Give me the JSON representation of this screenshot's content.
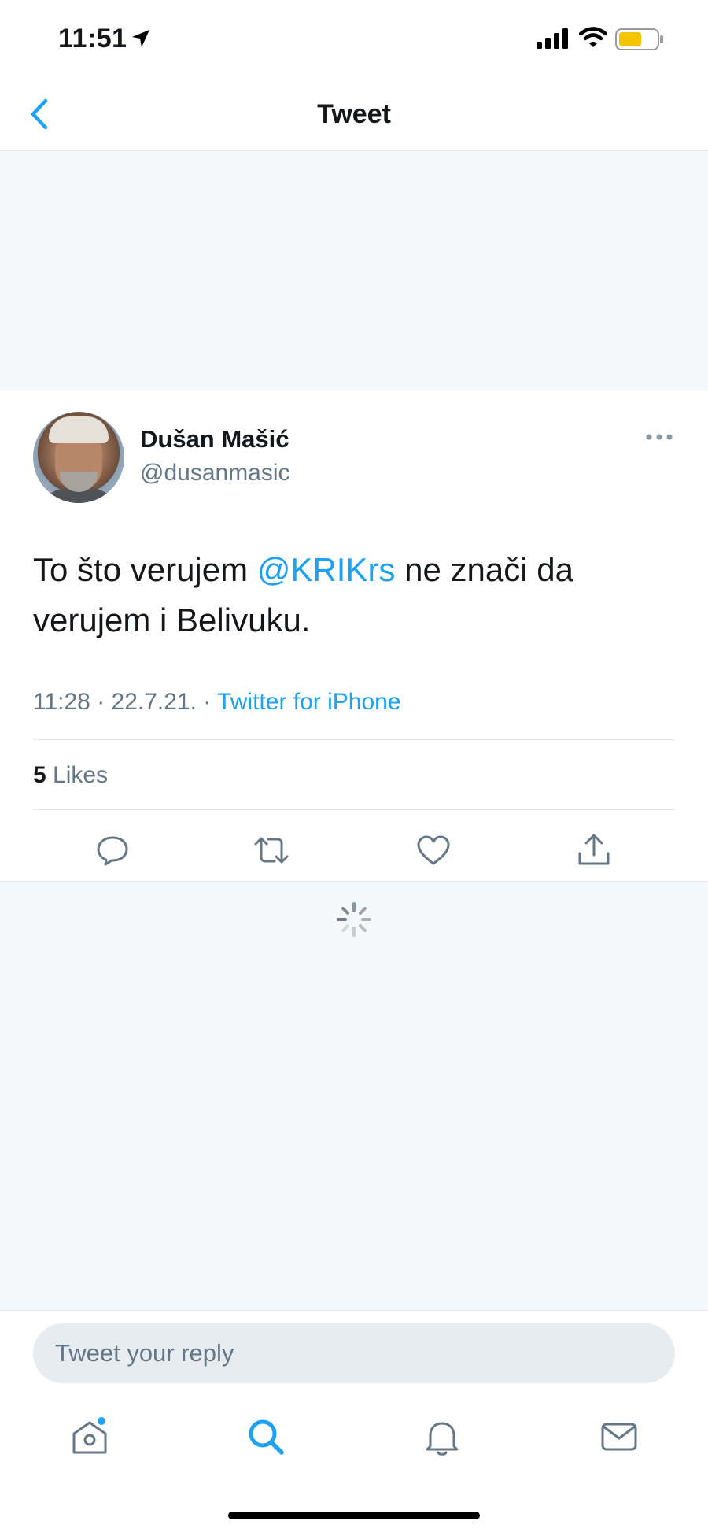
{
  "status_bar": {
    "time": "11:51",
    "icons": [
      "location-arrow-icon",
      "cellular-signal-icon",
      "wifi-icon",
      "battery-icon"
    ],
    "battery_color": "#f5c400"
  },
  "nav": {
    "title": "Tweet",
    "back_icon": "chevron-left-icon"
  },
  "tweet": {
    "author": {
      "display_name": "Dušan Mašić",
      "handle": "@dusanmasic"
    },
    "text_before": "To što verujem ",
    "mention": "@KRIKrs",
    "text_after": " ne znači da verujem i Belivuku.",
    "time": "11:28",
    "date": "22.7.21.",
    "source": "Twitter for iPhone",
    "meta_separator": " · ",
    "likes_count": "5",
    "likes_label": "Likes",
    "actions": [
      "reply-icon",
      "retweet-icon",
      "like-icon",
      "share-icon"
    ]
  },
  "reply": {
    "placeholder": "Tweet your reply"
  },
  "tab_bar": {
    "tabs": [
      "home-icon",
      "search-icon",
      "notifications-icon",
      "messages-icon"
    ],
    "active": "search-icon"
  },
  "colors": {
    "accent": "#1da1f2",
    "secondary_text": "#657786",
    "primary_text": "#14171a",
    "background": "#f5f8fa",
    "divider": "#e1e8ed"
  }
}
